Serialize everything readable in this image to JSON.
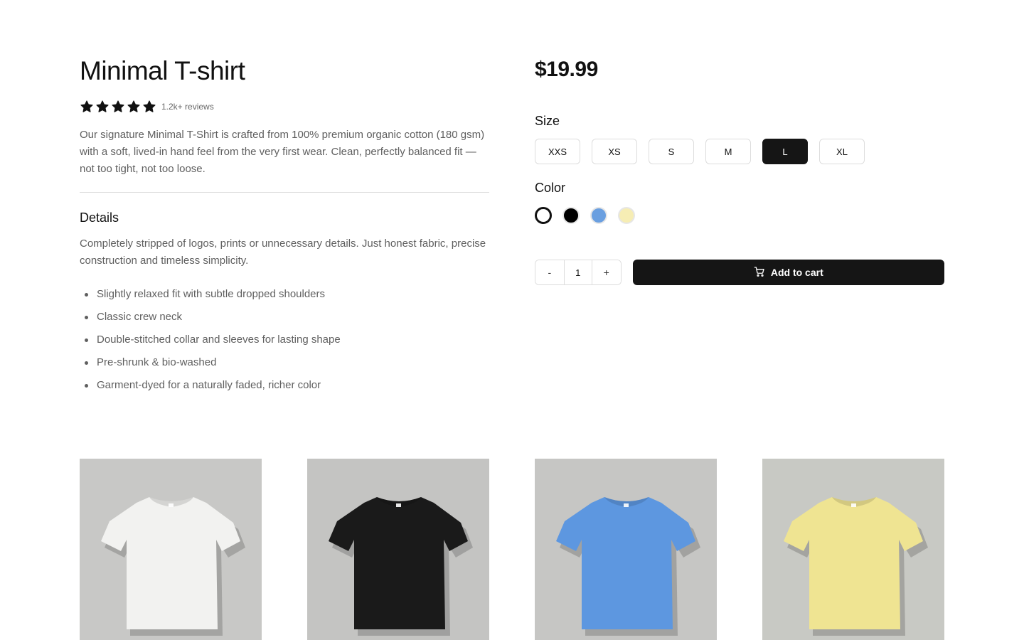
{
  "product": {
    "title": "Minimal T-shirt",
    "rating_stars": 5,
    "reviews_text": "1.2k+ reviews",
    "description": "Our signature Minimal T-Shirt is crafted from 100% premium organic cotton (180 gsm) with a soft, lived-in hand feel from the very first wear. Clean, perfectly balanced fit — not too tight, not too loose.",
    "details_heading": "Details",
    "details_text": "Completely stripped of logos, prints or unnecessary details. Just honest fabric, precise construction and timeless simplicity.",
    "features": [
      "Slightly relaxed fit with subtle dropped shoulders",
      "Classic crew neck",
      "Double-stitched collar and sleeves for lasting shape",
      "Pre-shrunk & bio-washed",
      "Garment-dyed for a naturally faded, richer color"
    ]
  },
  "purchase": {
    "price": "$19.99",
    "size_label": "Size",
    "sizes": [
      "XXS",
      "XS",
      "S",
      "M",
      "L",
      "XL"
    ],
    "selected_size": "L",
    "color_label": "Color",
    "colors": [
      {
        "name": "white",
        "hex": "#ffffff",
        "selected": true
      },
      {
        "name": "black",
        "hex": "#000000",
        "selected": false
      },
      {
        "name": "blue",
        "hex": "#6a9fe0",
        "selected": false
      },
      {
        "name": "yellow",
        "hex": "#f6edb4",
        "selected": false
      }
    ],
    "qty_minus": "-",
    "qty_value": "1",
    "qty_plus": "+",
    "add_to_cart": "Add to cart",
    "cart_icon": "cart-icon"
  },
  "gallery": [
    {
      "name": "white-tshirt",
      "shirt": "#f2f2f0",
      "bg": "#c8c8c6"
    },
    {
      "name": "black-tshirt",
      "shirt": "#1a1a1a",
      "bg": "#c4c4c2"
    },
    {
      "name": "blue-tshirt",
      "shirt": "#5d97e0",
      "bg": "#c6c6c4"
    },
    {
      "name": "yellow-tshirt",
      "shirt": "#efe492",
      "bg": "#c8c9c4"
    }
  ],
  "colors": {
    "accent": "#151515",
    "muted_text": "#5f5f5f",
    "border": "#dddddd"
  }
}
